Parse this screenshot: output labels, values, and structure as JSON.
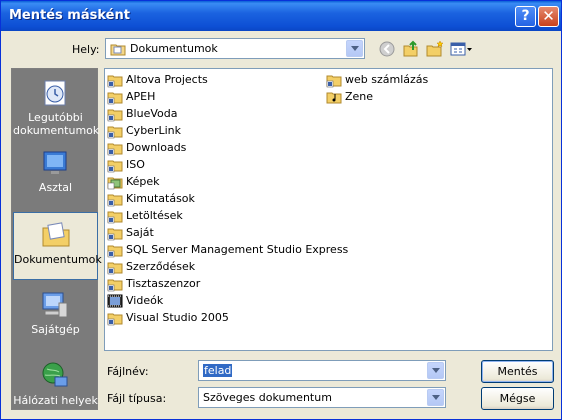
{
  "window": {
    "title": "Mentés másként"
  },
  "titlebar": {
    "help_glyph": "?",
    "close_glyph": "✕"
  },
  "lookin": {
    "label": "Hely:",
    "value": "Dokumentumok"
  },
  "places": [
    {
      "label": "Legutóbbi dokumentumok",
      "icon": "recent-documents-icon",
      "selected": false
    },
    {
      "label": "Asztal",
      "icon": "desktop-icon",
      "selected": false
    },
    {
      "label": "Dokumentumok",
      "icon": "my-documents-icon",
      "selected": true
    },
    {
      "label": "Sajátgép",
      "icon": "my-computer-icon",
      "selected": false
    },
    {
      "label": "Hálózati helyek",
      "icon": "network-places-icon",
      "selected": false
    }
  ],
  "files": [
    {
      "name": "Altova Projects",
      "icon": "folder-icon"
    },
    {
      "name": "APEH",
      "icon": "folder-icon"
    },
    {
      "name": "BlueVoda",
      "icon": "folder-icon"
    },
    {
      "name": "CyberLink",
      "icon": "folder-icon"
    },
    {
      "name": "Downloads",
      "icon": "folder-icon"
    },
    {
      "name": "ISO",
      "icon": "folder-icon"
    },
    {
      "name": "Képek",
      "icon": "pictures-folder-icon"
    },
    {
      "name": "Kimutatások",
      "icon": "folder-icon"
    },
    {
      "name": "Letöltések",
      "icon": "folder-icon"
    },
    {
      "name": "Saját",
      "icon": "folder-icon"
    },
    {
      "name": "SQL Server Management Studio Express",
      "icon": "folder-icon"
    },
    {
      "name": "Szerződések",
      "icon": "folder-icon"
    },
    {
      "name": "Tisztaszenzor",
      "icon": "folder-icon"
    },
    {
      "name": "Videók",
      "icon": "videos-folder-icon"
    },
    {
      "name": "Visual Studio 2005",
      "icon": "folder-icon"
    },
    {
      "name": "web számlázás",
      "icon": "folder-icon"
    },
    {
      "name": "Zene",
      "icon": "music-folder-icon"
    }
  ],
  "filename": {
    "label": "Fájlnév:",
    "value": "felad"
  },
  "filetype": {
    "label": "Fájl típusa:",
    "value": "Szöveges dokumentum"
  },
  "buttons": {
    "save": "Mentés",
    "cancel": "Mégse"
  }
}
